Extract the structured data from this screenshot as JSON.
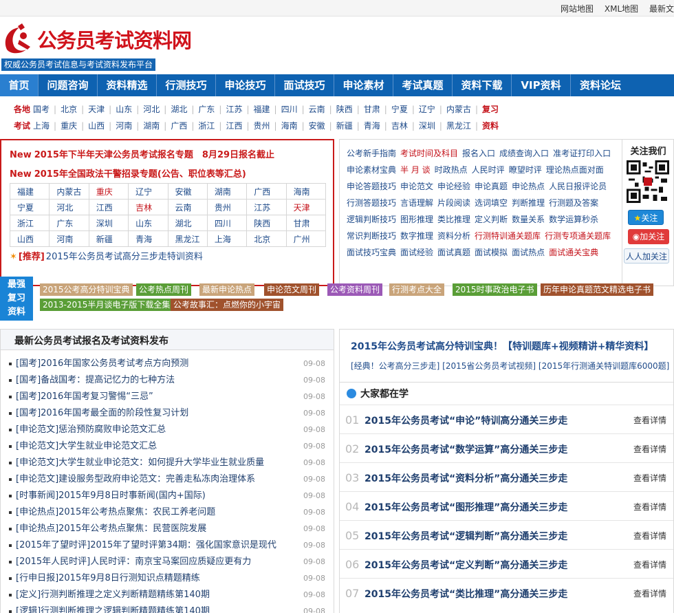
{
  "topbar": {
    "sitemap": "网站地图",
    "xml": "XML地图",
    "latest": "最新文"
  },
  "brand": {
    "name": "公务员考试资料网",
    "slogan": "权威公务员考试信息与考试资料发布平台"
  },
  "nav": [
    "首页",
    "问题咨询",
    "资料精选",
    "行测技巧",
    "申论技巧",
    "面试技巧",
    "申论素材",
    "考试真题",
    "资料下载",
    "VIP资料",
    "资料论坛"
  ],
  "regions": {
    "label1": "各地",
    "row1": [
      "国考",
      "北京",
      "天津",
      "山东",
      "河北",
      "湖北",
      "广东",
      "江苏",
      "福建",
      "四川",
      "云南",
      "陕西",
      "甘肃",
      "宁夏",
      "辽宁",
      "内蒙古"
    ],
    "row1_end": "复习",
    "label2": "考试",
    "row2": [
      "上海",
      "重庆",
      "山西",
      "河南",
      "湖南",
      "广西",
      "浙江",
      "江西",
      "贵州",
      "海南",
      "安徽",
      "新疆",
      "青海",
      "吉林",
      "深圳",
      "黑龙江"
    ],
    "row2_end": "资料"
  },
  "hot": {
    "new_label": "New",
    "h1": "2015年下半年天津公务员考试报名专题　8月29日报名截止",
    "h2": "2015年全国政法干警招录专题(公告、职位表等汇总)",
    "table": [
      [
        "福建",
        "内蒙古",
        "重庆",
        "辽宁",
        "安徽",
        "湖南",
        "广西",
        "海南"
      ],
      [
        "宁夏",
        "河北",
        "江西",
        "吉林",
        "云南",
        "贵州",
        "江苏",
        "天津"
      ],
      [
        "浙江",
        "广东",
        "深圳",
        "山东",
        "湖北",
        "四川",
        "陕西",
        "甘肃"
      ],
      [
        "山西",
        "河南",
        "新疆",
        "青海",
        "黑龙江",
        "上海",
        "北京",
        "广州"
      ]
    ],
    "rec_tag": "[推荐]",
    "rec_text": "2015年公务员考试高分三步走特训资料"
  },
  "mid": [
    [
      "公考新手指南",
      "考试时间及科目",
      "报名入口",
      "成绩查询入口",
      "准考证打印入口"
    ],
    [
      "申论素材宝典",
      "半 月 谈",
      "时政热点",
      "人民时评",
      "瞭望时评",
      "理论热点面对面"
    ],
    [
      "申论答题技巧",
      "申论范文",
      "申论经验",
      "申论真题",
      "申论热点",
      "人民日报评论员"
    ],
    [
      "行测答题技巧",
      "言语理解",
      "片段阅读",
      "选词填空",
      "判断推理",
      "行测题及答案"
    ],
    [
      "逻辑判断技巧",
      "图形推理",
      "类比推理",
      "定义判断",
      "数量关系",
      "数学运算秒杀"
    ],
    [
      "常识判断技巧",
      "数字推理",
      "资料分析",
      "行测特训通关题库",
      "行测专项通关题库"
    ],
    [
      "面试技巧宝典",
      "面试经验",
      "面试真题",
      "面试模拟",
      "面试热点",
      "面试通关宝典"
    ]
  ],
  "follow": {
    "title": "关注我们",
    "qq": "关注",
    "weibo": "加关注",
    "renren": "加关注"
  },
  "strong": {
    "label": "最强复习资料",
    "tags": [
      "2015公考高分特训宝典",
      "公考热点周刊",
      "最新申论热点",
      "申论范文周刊",
      "公考资料周刊",
      "行测考点大全",
      "2015时事政治电子书",
      "历年申论真题范文精选电子书",
      "2013-2015半月谈电子版下载全集",
      "公考故事汇：点燃你的小宇宙"
    ]
  },
  "latest": {
    "title": "最新公务员考试报名及考试资料发布",
    "items": [
      {
        "t": "[国考]2016年国家公务员考试考点方向预测",
        "d": "09-08"
      },
      {
        "t": "[国考]备战国考：提高记忆力的七种方法",
        "d": "09-08"
      },
      {
        "t": "[国考]2016年国考复习警惕“三忌”",
        "d": "09-08"
      },
      {
        "t": "[国考]2016年国考最全面的阶段性复习计划",
        "d": "09-08"
      },
      {
        "t": "[申论范文]惩治预防腐败申论范文汇总",
        "d": "09-08"
      },
      {
        "t": "[申论范文]大学生就业申论范文汇总",
        "d": "09-08"
      },
      {
        "t": "[申论范文]大学生就业申论范文：如何提升大学毕业生就业质量",
        "d": "09-08"
      },
      {
        "t": "[申论范文]建设服务型政府申论范文：完善走私冻肉治理体系",
        "d": "09-08"
      },
      {
        "t": "[时事新闻]2015年9月8日时事新闻(国内+国际)",
        "d": "09-08"
      },
      {
        "t": "[申论热点]2015年公考热点聚焦：农民工养老问题",
        "d": "09-08"
      },
      {
        "t": "[申论热点]2015年公考热点聚焦：民营医院发展",
        "d": "09-08"
      },
      {
        "t": "[2015年了望时评]2015年了望时评第34期：强化国家意识是现代",
        "d": "09-08"
      },
      {
        "t": "[2015年人民时评]人民时评：南京宝马案回应质疑应更有力",
        "d": "09-08"
      },
      {
        "t": "[行申日报]2015年9月8日行测知识点精题精练",
        "d": "09-08"
      },
      {
        "t": "[定义]行测判断推理之定义判断精题精练第140期",
        "d": "09-08"
      },
      {
        "t": "[逻辑]行测判断推理之逻辑判断精题精练第140期",
        "d": "09-08"
      }
    ]
  },
  "featured": {
    "title": "2015年公务员考试高分特训宝典！【特训题库+视频精讲+精华资料】",
    "sub": "[经典！公考高分三步走] [2015省公务员考试视频] [2015年行测通关特训题库6000题]"
  },
  "popular": {
    "title": "大家都在学",
    "more": "查看详情",
    "items": [
      {
        "n": "01",
        "t": "2015年公务员考试“申论”特训高分通关三步走"
      },
      {
        "n": "02",
        "t": "2015年公务员考试“数学运算”高分通关三步走"
      },
      {
        "n": "03",
        "t": "2015年公务员考试“资料分析”高分通关三步走"
      },
      {
        "n": "04",
        "t": "2015年公务员考试“图形推理”高分通关三步走"
      },
      {
        "n": "05",
        "t": "2015年公务员考试“逻辑判断”高分通关三步走"
      },
      {
        "n": "06",
        "t": "2015年公务员考试“定义判断”高分通关三步走"
      },
      {
        "n": "07",
        "t": "2015年公务员考试“类比推理”高分通关三步走"
      }
    ]
  },
  "colors": {
    "brand_red": "#d0121b",
    "nav_blue": "#0e62b1",
    "link_blue": "#1f4b8a"
  }
}
